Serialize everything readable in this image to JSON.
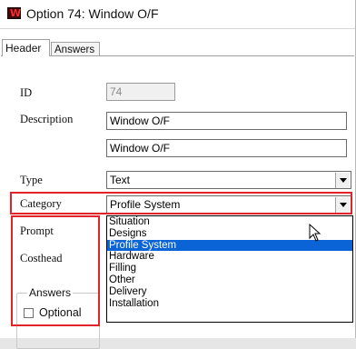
{
  "window": {
    "title": "Option 74: Window O/F"
  },
  "tabs": [
    {
      "label": "Header"
    },
    {
      "label": "Answers"
    }
  ],
  "form": {
    "id": {
      "label": "ID",
      "value": "74"
    },
    "description": {
      "label": "Description",
      "value": "Window O/F",
      "value2": "Window O/F"
    },
    "type": {
      "label": "Type",
      "value": "Text"
    },
    "category": {
      "label": "Category",
      "value": "Profile System"
    },
    "prompt": {
      "label": "Prompt"
    },
    "costhead": {
      "label": "Costhead"
    }
  },
  "dropdown": {
    "options": [
      "Situation",
      "Designs",
      "Profile System",
      "Hardware",
      "Filling",
      "Other",
      "Delivery",
      "Installation"
    ],
    "selected_index": 2
  },
  "answers_group": {
    "legend": "Answers",
    "optional_label": "Optional"
  },
  "colors": {
    "highlight_box": "#e0242a",
    "selection": "#0a64d6",
    "icon": "#ff2a2a"
  }
}
